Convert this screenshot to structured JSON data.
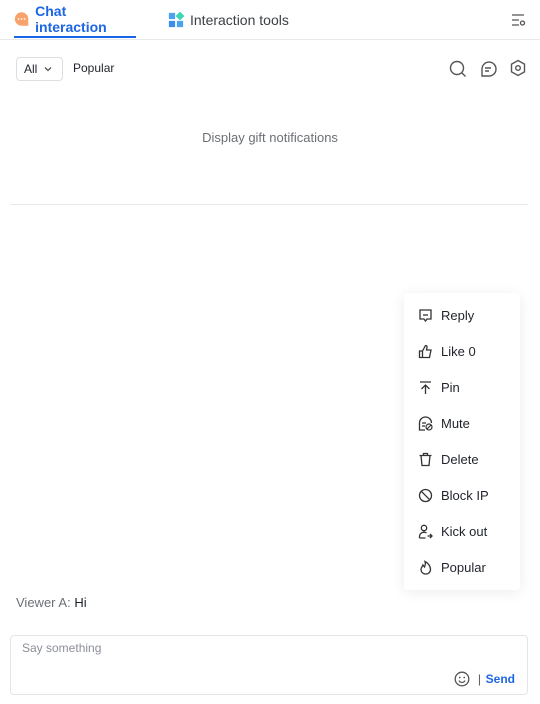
{
  "tabs": [
    {
      "label": "Chat interaction",
      "icon": "chat-bubble-icon",
      "active": true
    },
    {
      "label": "Interaction tools",
      "icon": "tools-grid-icon",
      "active": false
    }
  ],
  "filter": {
    "selected": "All",
    "popular_label": "Popular"
  },
  "gift_notice": "Display gift notifications",
  "context_menu": [
    {
      "label": "Reply",
      "icon": "reply-icon"
    },
    {
      "label": "Like 0",
      "icon": "thumbs-up-icon"
    },
    {
      "label": "Pin",
      "icon": "pin-top-icon"
    },
    {
      "label": "Mute",
      "icon": "mute-icon"
    },
    {
      "label": "Delete",
      "icon": "trash-icon"
    },
    {
      "label": "Block IP",
      "icon": "block-icon"
    },
    {
      "label": "Kick out",
      "icon": "kick-user-icon"
    },
    {
      "label": "Popular",
      "icon": "flame-icon"
    }
  ],
  "message": {
    "sender": "Viewer A:",
    "text": "Hi"
  },
  "composer": {
    "placeholder": "Say something",
    "separator": "|",
    "send_label": "Send"
  },
  "colors": {
    "accent": "#1c66e5",
    "chat_icon": "#f7a36b"
  }
}
